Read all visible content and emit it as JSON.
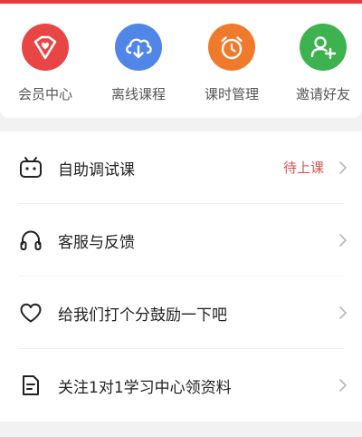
{
  "quick_actions": [
    {
      "label": "会员中心",
      "icon": "heart-badge-icon",
      "color": "#e84545"
    },
    {
      "label": "离线课程",
      "icon": "cloud-download-icon",
      "color": "#4f86e8"
    },
    {
      "label": "课时管理",
      "icon": "alarm-clock-icon",
      "color": "#f07a2c"
    },
    {
      "label": "邀请好友",
      "icon": "add-user-icon",
      "color": "#3cb34e"
    }
  ],
  "menu": [
    {
      "label": "自助调试课",
      "status": "待上课",
      "icon": "robot-icon"
    },
    {
      "label": "客服与反馈",
      "status": "",
      "icon": "headphones-icon"
    },
    {
      "label": "给我们打个分鼓励一下吧",
      "status": "",
      "icon": "heart-outline-icon"
    },
    {
      "label": "关注1对1学习中心领资料",
      "status": "",
      "icon": "document-icon"
    }
  ],
  "colors": {
    "accent_red": "#e73c3c",
    "status_red": "#d9534f"
  }
}
